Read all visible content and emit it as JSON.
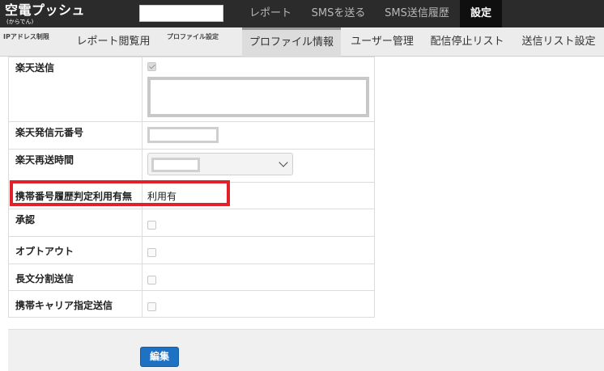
{
  "header": {
    "logo_text": "空電プッシュ",
    "logo_subtext": "(からでん)",
    "nav": [
      {
        "label": "レポート"
      },
      {
        "label": "SMSを送る"
      },
      {
        "label": "SMS送信履歴"
      },
      {
        "label": "設定",
        "active": true
      }
    ]
  },
  "subnav": {
    "small_items": [
      "IPアドレス制限",
      "プロファイル設定"
    ],
    "items": [
      {
        "label": "レポート閲覧用"
      },
      {
        "label": "プロファイル情報",
        "active": true
      },
      {
        "label": "ユーザー管理"
      },
      {
        "label": "配信停止リスト"
      },
      {
        "label": "送信リスト設定"
      }
    ]
  },
  "form": {
    "rows": [
      {
        "label": "楽天送信",
        "checked": true
      },
      {
        "label": "楽天発信元番号"
      },
      {
        "label": "楽天再送時間"
      },
      {
        "label": "携帯番号履歴判定利用有無",
        "value": "利用有"
      },
      {
        "label": "承認",
        "checked": false
      },
      {
        "label": "オプトアウト",
        "checked": false
      },
      {
        "label": "長文分割送信",
        "checked": false
      },
      {
        "label": "携帯キャリア指定送信",
        "checked": false
      }
    ]
  },
  "footer": {
    "edit_label": "編集"
  },
  "colors": {
    "topbar": "#2b2b2b",
    "highlight": "#e0202a",
    "button": "#1d72c4"
  }
}
